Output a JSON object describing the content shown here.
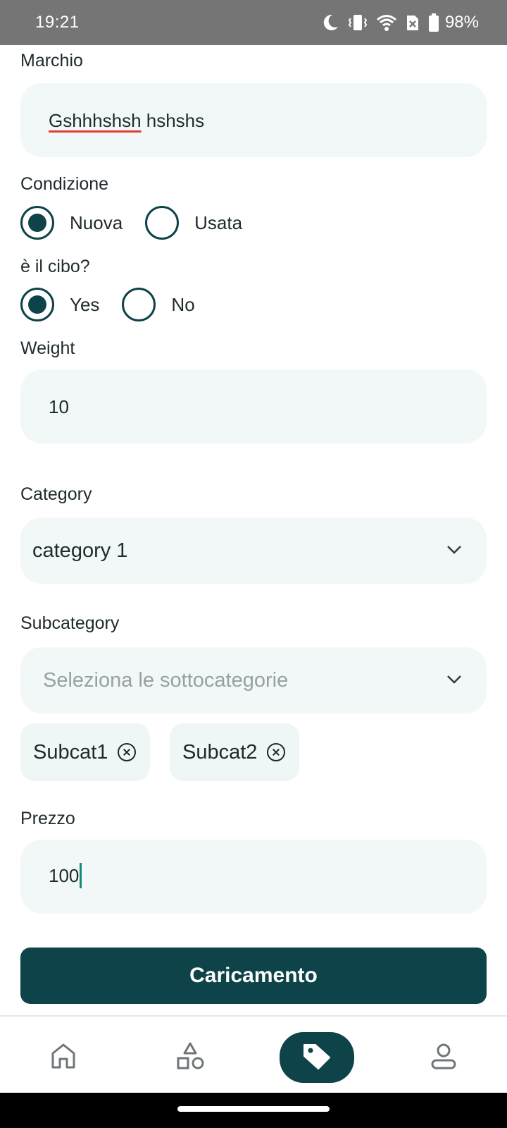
{
  "status_bar": {
    "time": "19:21",
    "battery_percent": "98%",
    "icons": [
      "moon-icon",
      "vibrate-icon",
      "wifi-icon",
      "sim-icon",
      "battery-icon"
    ]
  },
  "form": {
    "brand": {
      "label": "Marchio",
      "value_underlined": "Gshhhshsh",
      "value_rest": " hshshs"
    },
    "condition": {
      "label": "Condizione",
      "options": [
        {
          "label": "Nuova",
          "checked": true
        },
        {
          "label": "Usata",
          "checked": false
        }
      ]
    },
    "is_food": {
      "label": "è il cibo?",
      "options": [
        {
          "label": "Yes",
          "checked": true
        },
        {
          "label": "No",
          "checked": false
        }
      ]
    },
    "weight": {
      "label": "Weight",
      "value": "10"
    },
    "category": {
      "label": "Category",
      "selected": "category 1"
    },
    "subcategory": {
      "label": "Subcategory",
      "placeholder": "Seleziona le sottocategorie",
      "chips": [
        "Subcat1",
        "Subcat2"
      ]
    },
    "price": {
      "label": "Prezzo",
      "value": "100"
    },
    "submit_label": "Caricamento"
  },
  "bottom_nav": {
    "items": [
      {
        "icon": "home-icon",
        "active": false
      },
      {
        "icon": "shapes-icon",
        "active": false
      },
      {
        "icon": "tag-icon",
        "active": true
      },
      {
        "icon": "profile-icon",
        "active": false
      }
    ]
  },
  "colors": {
    "primary": "#0d4349",
    "field_bg": "#f2f8f8",
    "status_bar": "#757575",
    "cursor": "#15897a",
    "spell_underline": "#e53935"
  }
}
